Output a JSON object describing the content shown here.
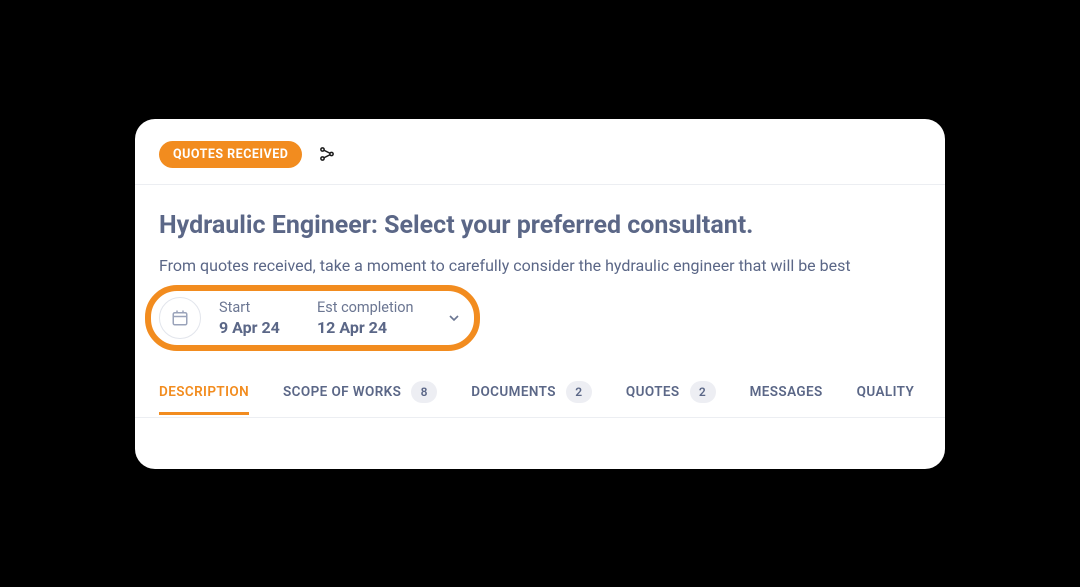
{
  "status_badge": "QUOTES RECEIVED",
  "page_title": "Hydraulic Engineer: Select your preferred consultant.",
  "subtitle": "From quotes received, take a moment to carefully consider the hydraulic engineer that will be best",
  "dates": {
    "start_label": "Start",
    "start_value": "9 Apr 24",
    "completion_label": "Est completion",
    "completion_value": "12 Apr 24"
  },
  "tabs": [
    {
      "label": "DESCRIPTION",
      "count": null,
      "active": true
    },
    {
      "label": "SCOPE OF WORKS",
      "count": "8",
      "active": false
    },
    {
      "label": "DOCUMENTS",
      "count": "2",
      "active": false
    },
    {
      "label": "QUOTES",
      "count": "2",
      "active": false
    },
    {
      "label": "MESSAGES",
      "count": null,
      "active": false
    },
    {
      "label": "QUALITY",
      "count": null,
      "active": false
    }
  ]
}
